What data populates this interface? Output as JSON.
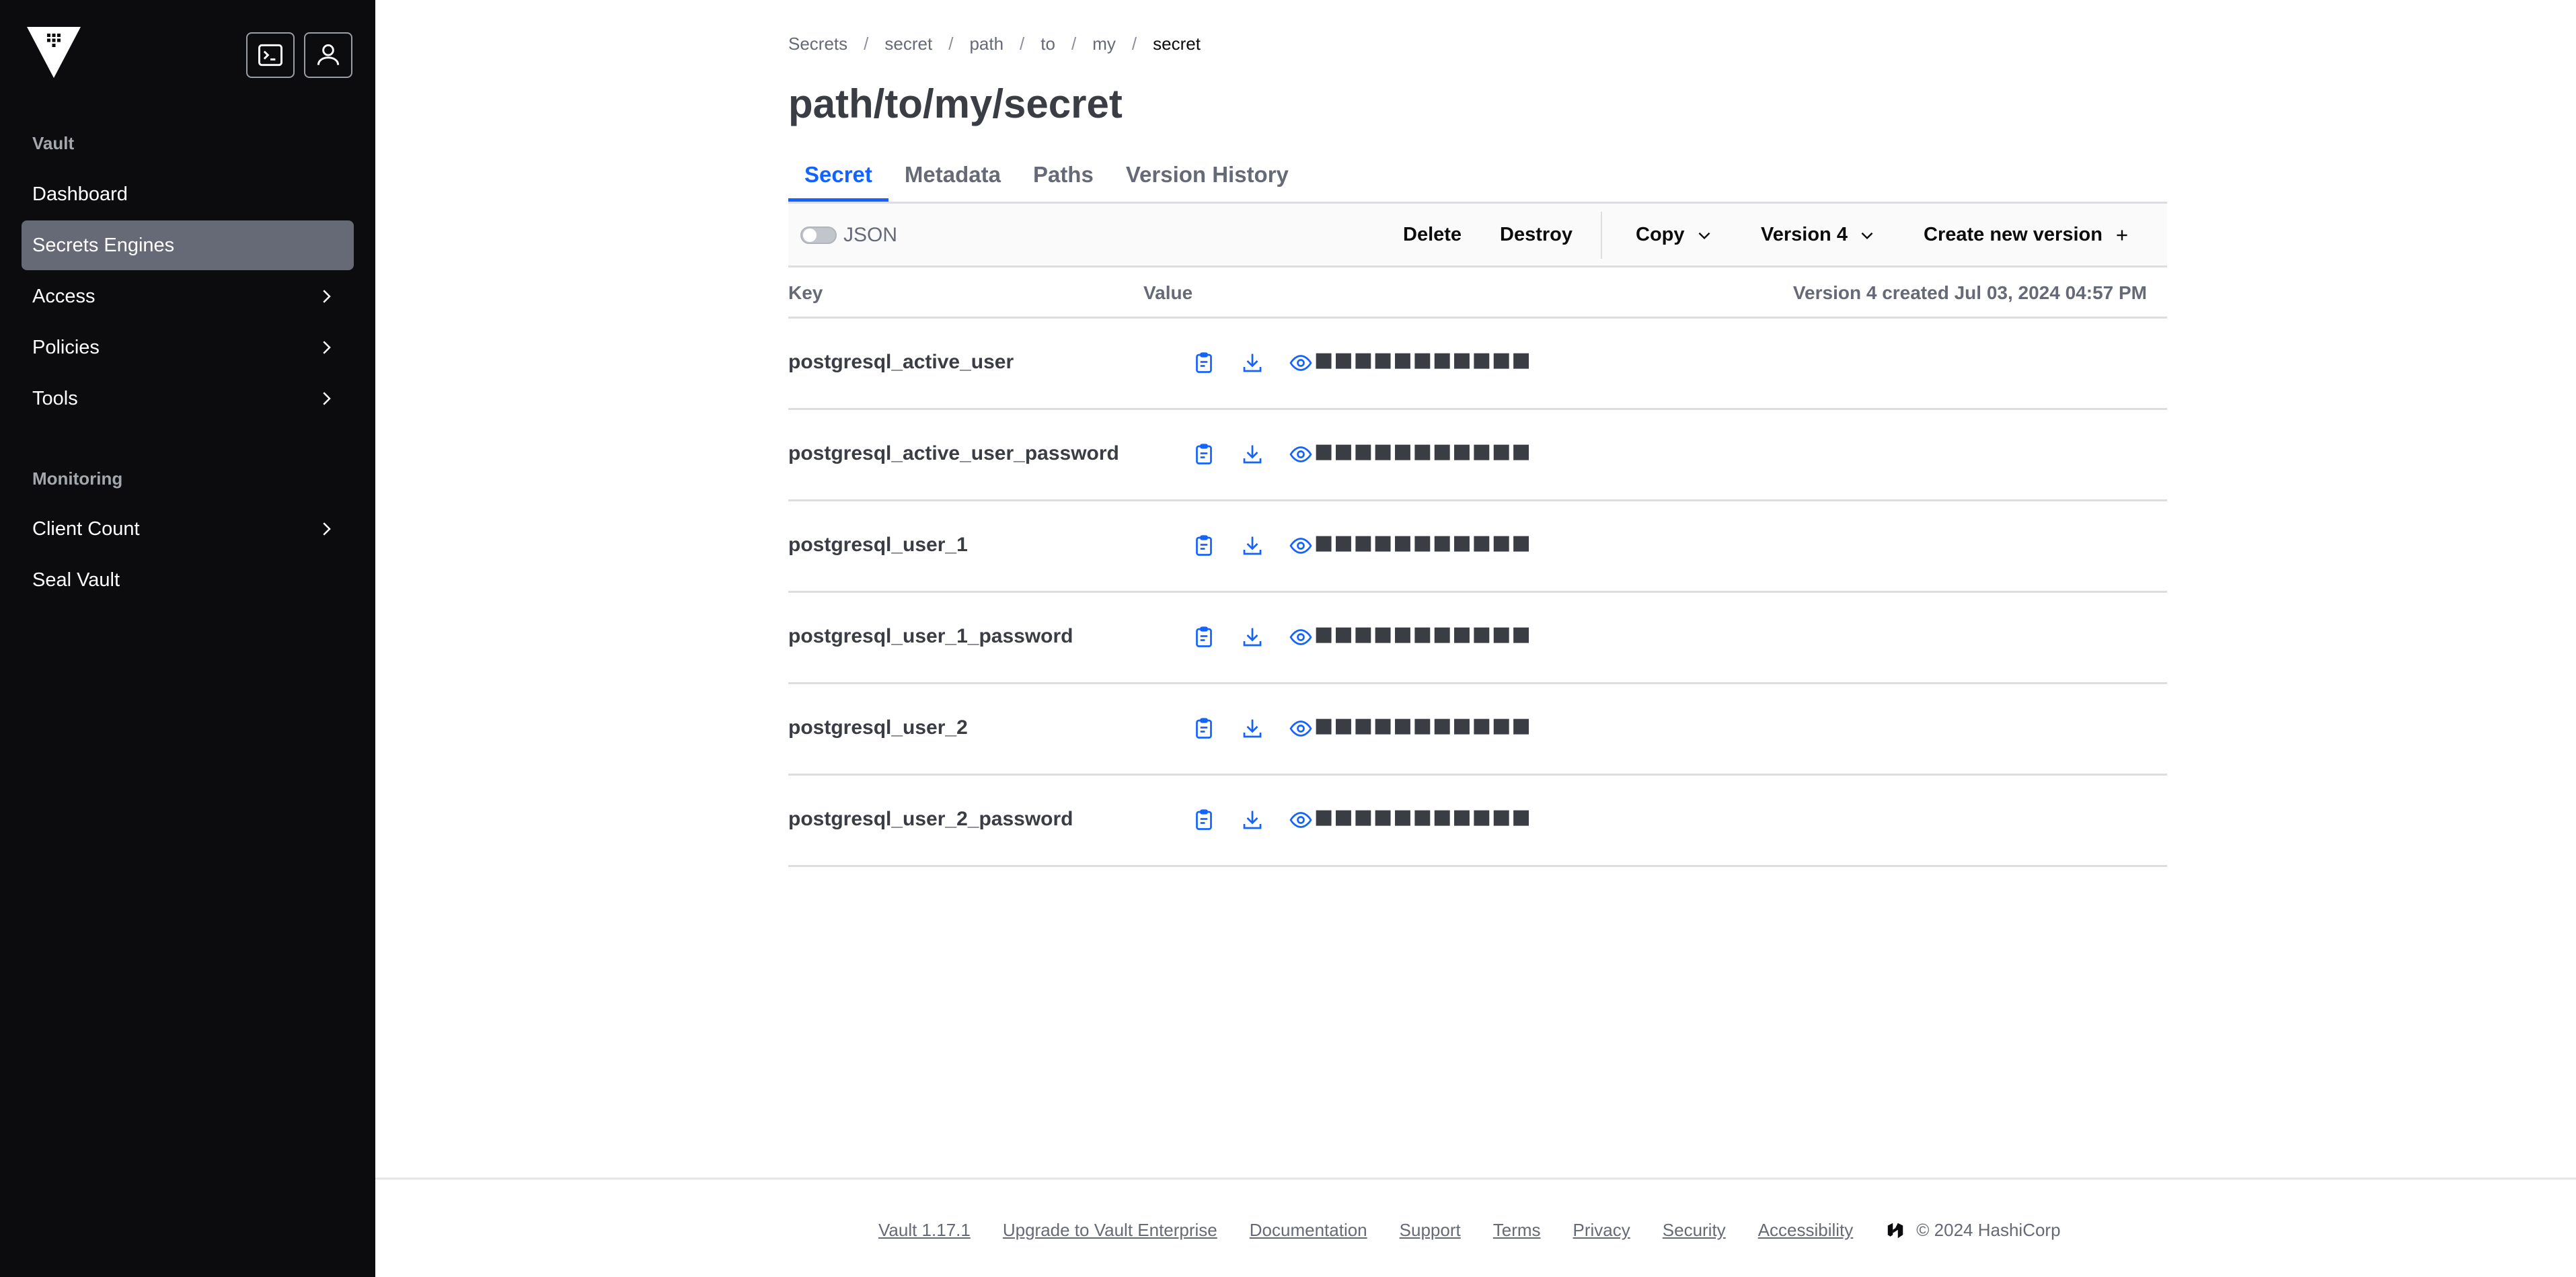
{
  "sidebar": {
    "logo_name": "vault-logo",
    "sections": [
      {
        "title": "Vault",
        "items": [
          {
            "label": "Dashboard",
            "active": false,
            "has_chevron": false
          },
          {
            "label": "Secrets Engines",
            "active": true,
            "has_chevron": false
          },
          {
            "label": "Access",
            "active": false,
            "has_chevron": true
          },
          {
            "label": "Policies",
            "active": false,
            "has_chevron": true
          },
          {
            "label": "Tools",
            "active": false,
            "has_chevron": true
          }
        ]
      },
      {
        "title": "Monitoring",
        "items": [
          {
            "label": "Client Count",
            "active": false,
            "has_chevron": true
          },
          {
            "label": "Seal Vault",
            "active": false,
            "has_chevron": false
          }
        ]
      }
    ]
  },
  "breadcrumb": [
    "Secrets",
    "secret",
    "path",
    "to",
    "my",
    "secret"
  ],
  "page_title": "path/to/my/secret",
  "tabs": [
    {
      "label": "Secret",
      "active": true
    },
    {
      "label": "Metadata",
      "active": false
    },
    {
      "label": "Paths",
      "active": false
    },
    {
      "label": "Version History",
      "active": false
    }
  ],
  "toolbar": {
    "json_label": "JSON",
    "delete_label": "Delete",
    "destroy_label": "Destroy",
    "copy_label": "Copy",
    "version_label": "Version 4",
    "create_label": "Create new version"
  },
  "table": {
    "key_header": "Key",
    "value_header": "Value",
    "version_info": "Version 4 created Jul 03, 2024 04:57 PM",
    "rows": [
      {
        "key": "postgresql_active_user",
        "masked": "■■■■■■■■■■■"
      },
      {
        "key": "postgresql_active_user_password",
        "masked": "■■■■■■■■■■■"
      },
      {
        "key": "postgresql_user_1",
        "masked": "■■■■■■■■■■■"
      },
      {
        "key": "postgresql_user_1_password",
        "masked": "■■■■■■■■■■■"
      },
      {
        "key": "postgresql_user_2",
        "masked": "■■■■■■■■■■■"
      },
      {
        "key": "postgresql_user_2_password",
        "masked": "■■■■■■■■■■■"
      }
    ]
  },
  "footer": {
    "links": [
      "Vault 1.17.1",
      "Upgrade to Vault Enterprise",
      "Documentation",
      "Support",
      "Terms",
      "Privacy",
      "Security",
      "Accessibility"
    ],
    "copyright": "© 2024 HashiCorp"
  },
  "colors": {
    "sidebar_bg": "#0c0c0e",
    "active_nav": "#656a76",
    "accent": "#1563ff"
  }
}
